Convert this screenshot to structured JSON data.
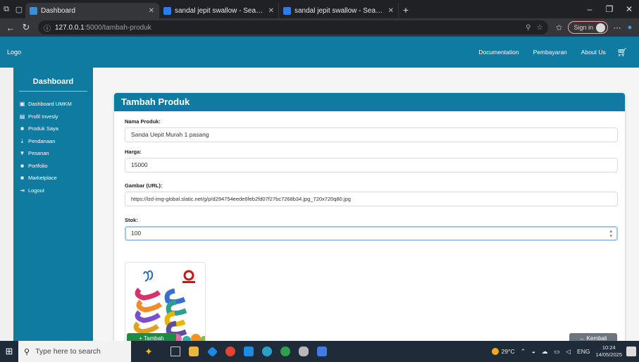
{
  "browser": {
    "tabs": [
      {
        "title": "Dashboard",
        "active": true,
        "icon_color": "#3b8fd9"
      },
      {
        "title": "sandal jepit swallow - Search",
        "active": false,
        "icon_color": "#2b7de9"
      },
      {
        "title": "sandal jepit swallow - Search Ima",
        "active": false,
        "icon_color": "#2b7de9"
      }
    ],
    "url_host": "127.0.0.1",
    "url_path": ":5000/tambah-produk",
    "signin_label": "Sign in"
  },
  "navbar": {
    "logo": "Logo",
    "links": [
      "Documentation",
      "Pembayaran",
      "About Us"
    ],
    "cart_icon": "cart-icon"
  },
  "sidebar": {
    "title": "Dashboard",
    "items": [
      {
        "label": "Dashboard UMKM",
        "icon": "dashboard-icon",
        "glyph": "▣"
      },
      {
        "label": "Profil Invesly",
        "icon": "profile-icon",
        "glyph": "▤"
      },
      {
        "label": "Produk Saya",
        "icon": "box-icon",
        "glyph": "■"
      },
      {
        "label": "Pendanaan",
        "icon": "funding-icon",
        "glyph": "⇣"
      },
      {
        "label": "Pesanan",
        "icon": "cart-icon",
        "glyph": "▼"
      },
      {
        "label": "Portfolio",
        "icon": "briefcase-icon",
        "glyph": "■"
      },
      {
        "label": "Marketplace",
        "icon": "store-icon",
        "glyph": "■"
      },
      {
        "label": "Logout",
        "icon": "logout-icon",
        "glyph": "⇥"
      }
    ]
  },
  "form": {
    "title": "Tambah Produk",
    "nama_label": "Nama Produk:",
    "nama_value": "Sanda Uepit Murah 1 pasang",
    "harga_label": "Harga:",
    "harga_value": "15000",
    "gambar_label": "Gambar (URL):",
    "gambar_value": "https://lzd-img-global.slatic.net/g/p/d294754eede6feb2fd07f27bc7268b34.jpg_720x720q80.jpg",
    "stok_label": "Stok:",
    "stok_value": "100",
    "submit_label": "+ Tambah",
    "back_label": "← Kembali"
  },
  "taskbar": {
    "search_placeholder": "Type here to search",
    "weather": "29°C",
    "lang": "ENG",
    "time": "10:24",
    "date": "14/05/2025"
  }
}
